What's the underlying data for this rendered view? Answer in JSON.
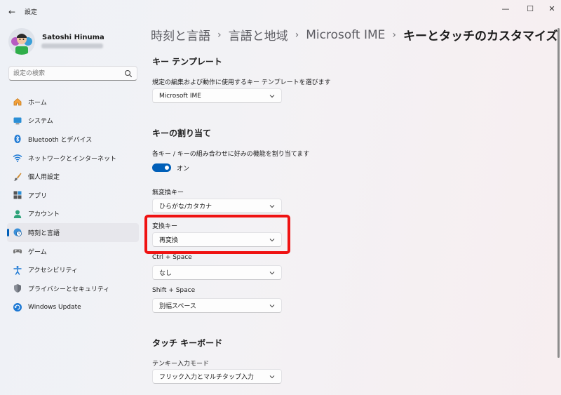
{
  "window": {
    "title": "設定",
    "back_glyph": "←",
    "minimize_glyph": "—",
    "maximize_glyph": "☐",
    "close_glyph": "✕"
  },
  "profile": {
    "name": "Satoshi Hinuma"
  },
  "search": {
    "placeholder": "設定の検索"
  },
  "nav": {
    "items": [
      {
        "label": "ホーム",
        "icon": "home-icon"
      },
      {
        "label": "システム",
        "icon": "system-icon"
      },
      {
        "label": "Bluetooth とデバイス",
        "icon": "bluetooth-icon"
      },
      {
        "label": "ネットワークとインターネット",
        "icon": "wifi-icon"
      },
      {
        "label": "個人用設定",
        "icon": "brush-icon"
      },
      {
        "label": "アプリ",
        "icon": "apps-icon"
      },
      {
        "label": "アカウント",
        "icon": "account-icon"
      },
      {
        "label": "時刻と言語",
        "icon": "time-language-icon",
        "active": true
      },
      {
        "label": "ゲーム",
        "icon": "gamepad-icon"
      },
      {
        "label": "アクセシビリティ",
        "icon": "accessibility-icon"
      },
      {
        "label": "プライバシーとセキュリティ",
        "icon": "shield-icon"
      },
      {
        "label": "Windows Update",
        "icon": "update-icon"
      }
    ]
  },
  "breadcrumb": {
    "items": [
      "時刻と言語",
      "言語と地域",
      "Microsoft IME"
    ],
    "separator": "›",
    "current": "キーとタッチのカスタマイズ"
  },
  "key_template": {
    "title": "キー テンプレート",
    "description": "規定の編集および動作に使用するキー テンプレートを選びます",
    "value": "Microsoft IME"
  },
  "key_assign": {
    "title": "キーの割り当て",
    "description": "各キー / キーの組み合わせに好みの機能を割り当てます",
    "toggle_state": "オン",
    "fields": {
      "muhenkan": {
        "label": "無変換キー",
        "value": "ひらがな/カタカナ"
      },
      "henkan": {
        "label": "変換キー",
        "value": "再変換"
      },
      "ctrl_space": {
        "label": "Ctrl + Space",
        "value": "なし"
      },
      "shift_space": {
        "label": "Shift + Space",
        "value": "別幅スペース"
      }
    }
  },
  "touch_keyboard": {
    "title": "タッチ キーボード",
    "tenkey_label": "テンキー入力モード",
    "tenkey_value": "フリック入力とマルチタップ入力"
  },
  "colors": {
    "accent": "#005fb8",
    "highlight": "#ef1212"
  }
}
